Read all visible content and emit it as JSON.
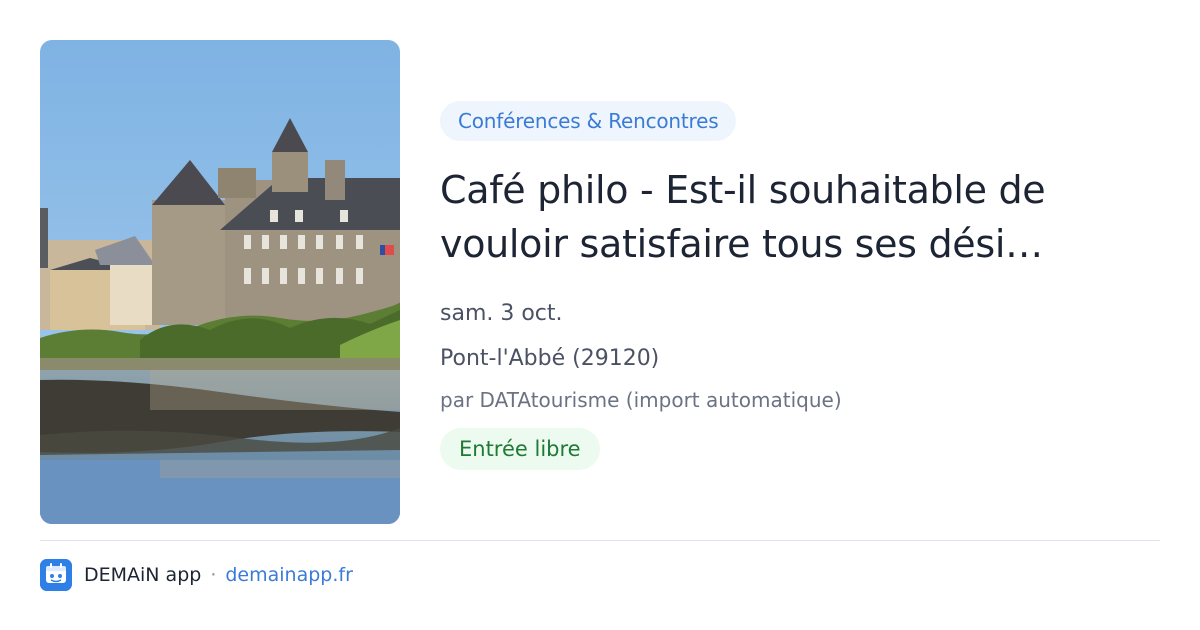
{
  "event": {
    "category": "Conférences & Rencontres",
    "title_line1": "Café philo - Est-il souhaitable de",
    "title_line2": "vouloir satisfaire tous ses dési…",
    "date": "sam. 3 oct.",
    "location": "Pont-l'Abbé (29120)",
    "author": "par DATAtourisme (import automatique)",
    "price": "Entrée libre",
    "photo_icon": "chateau-photo"
  },
  "footer": {
    "app_name": "DEMAiN app",
    "separator": "·",
    "url": "demainapp.fr",
    "logo_icon": "demain-logo-icon"
  },
  "colors": {
    "category_text": "#3b7bd6",
    "category_bg": "#eef5fd",
    "price_text": "#1f7a35",
    "price_bg": "#ecfaef",
    "title": "#1d2433",
    "link": "#3b7bd6"
  }
}
